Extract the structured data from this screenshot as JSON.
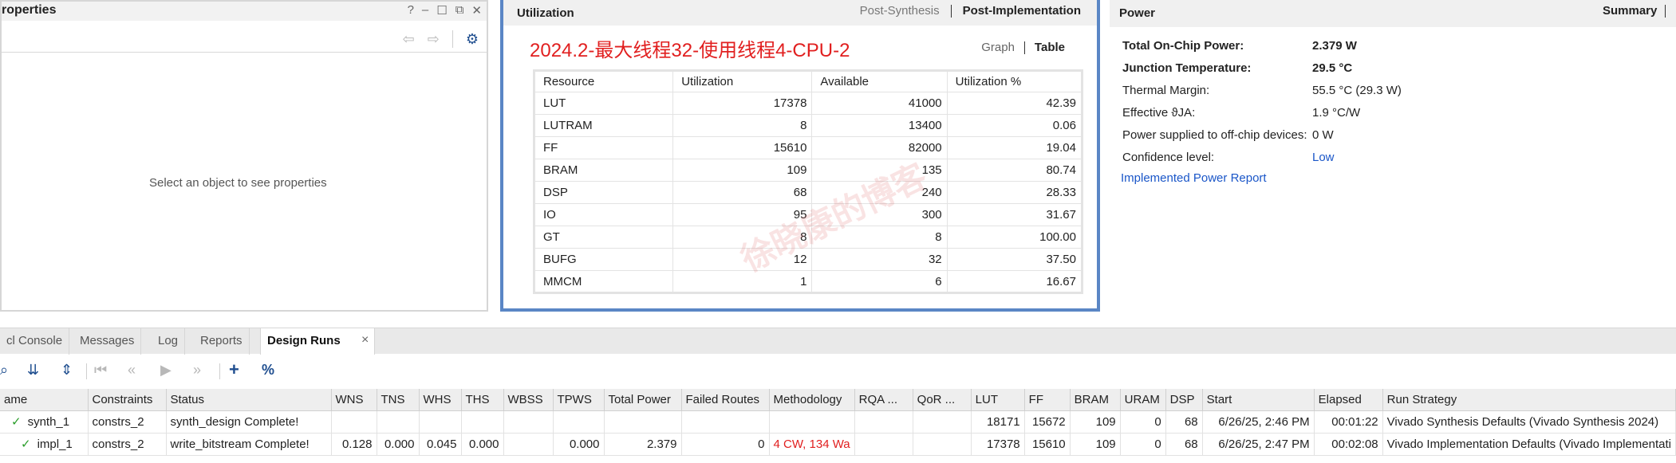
{
  "properties": {
    "title": "roperties",
    "icons": [
      "help-icon",
      "minimize-icon",
      "restore-icon",
      "float-icon",
      "close-icon"
    ],
    "empty_message": "Select an object to see properties"
  },
  "utilization": {
    "title": "Utilization",
    "tabs": [
      "Post-Synthesis",
      "Post-Implementation"
    ],
    "run_title": "2024.2-最大线程32-使用线程4-CPU-2",
    "views": [
      "Graph",
      "Table"
    ],
    "columns": [
      "Resource",
      "Utilization",
      "Available",
      "Utilization %"
    ],
    "rows": [
      [
        "LUT",
        "17378",
        "41000",
        "42.39"
      ],
      [
        "LUTRAM",
        "8",
        "13400",
        "0.06"
      ],
      [
        "FF",
        "15610",
        "82000",
        "19.04"
      ],
      [
        "BRAM",
        "109",
        "135",
        "80.74"
      ],
      [
        "DSP",
        "68",
        "240",
        "28.33"
      ],
      [
        "IO",
        "95",
        "300",
        "31.67"
      ],
      [
        "GT",
        "8",
        "8",
        "100.00"
      ],
      [
        "BUFG",
        "12",
        "32",
        "37.50"
      ],
      [
        "MMCM",
        "1",
        "6",
        "16.67"
      ]
    ]
  },
  "power": {
    "title": "Power",
    "summary_tab": "Summary",
    "rows": [
      {
        "label": "Total On-Chip Power:",
        "value": "2.379 W",
        "bold": true
      },
      {
        "label": "Junction Temperature:",
        "value": "29.5 °C",
        "bold": true
      },
      {
        "label": "Thermal Margin:",
        "value": "55.5 °C (29.3 W)",
        "bold": false
      },
      {
        "label": "Effective ϑJA:",
        "value": "1.9 °C/W",
        "bold": false
      },
      {
        "label": "Power supplied to off-chip devices:",
        "value": "0 W",
        "bold": false
      },
      {
        "label": "Confidence level:",
        "value": "Low",
        "bold": false,
        "link": true
      }
    ],
    "report_link": "Implemented Power Report"
  },
  "bottom_tabs": {
    "tabs": [
      "cl Console",
      "Messages",
      "Log",
      "Reports",
      "Design Runs"
    ],
    "active": "Design Runs"
  },
  "runs": {
    "columns": [
      "ame",
      "Constraints",
      "Status",
      "WNS",
      "TNS",
      "WHS",
      "THS",
      "WBSS",
      "TPWS",
      "Total Power",
      "Failed Routes",
      "Methodology",
      "RQA ...",
      "QoR ...",
      "LUT",
      "FF",
      "BRAM",
      "URAM",
      "DSP",
      "Start",
      "Elapsed",
      "Run Strategy"
    ],
    "rows": [
      [
        "synth_1",
        "constrs_2",
        "synth_design Complete!",
        "",
        "",
        "",
        "",
        "",
        "",
        "",
        "",
        "",
        "",
        "",
        "18171",
        "15672",
        "109",
        "0",
        "68",
        "6/26/25, 2:46 PM",
        "00:01:22",
        "Vivado Synthesis Defaults (Vivado Synthesis 2024)"
      ],
      [
        "impl_1",
        "constrs_2",
        "write_bitstream Complete!",
        "0.128",
        "0.000",
        "0.045",
        "0.000",
        "",
        "0.000",
        "2.379",
        "0",
        "4 CW, 134 Wa",
        "",
        "",
        "17378",
        "15610",
        "109",
        "0",
        "68",
        "6/26/25, 2:47 PM",
        "00:02:08",
        "Vivado Implementation Defaults (Vivado Implementati"
      ]
    ]
  },
  "watermark": "徐晓康的博客"
}
